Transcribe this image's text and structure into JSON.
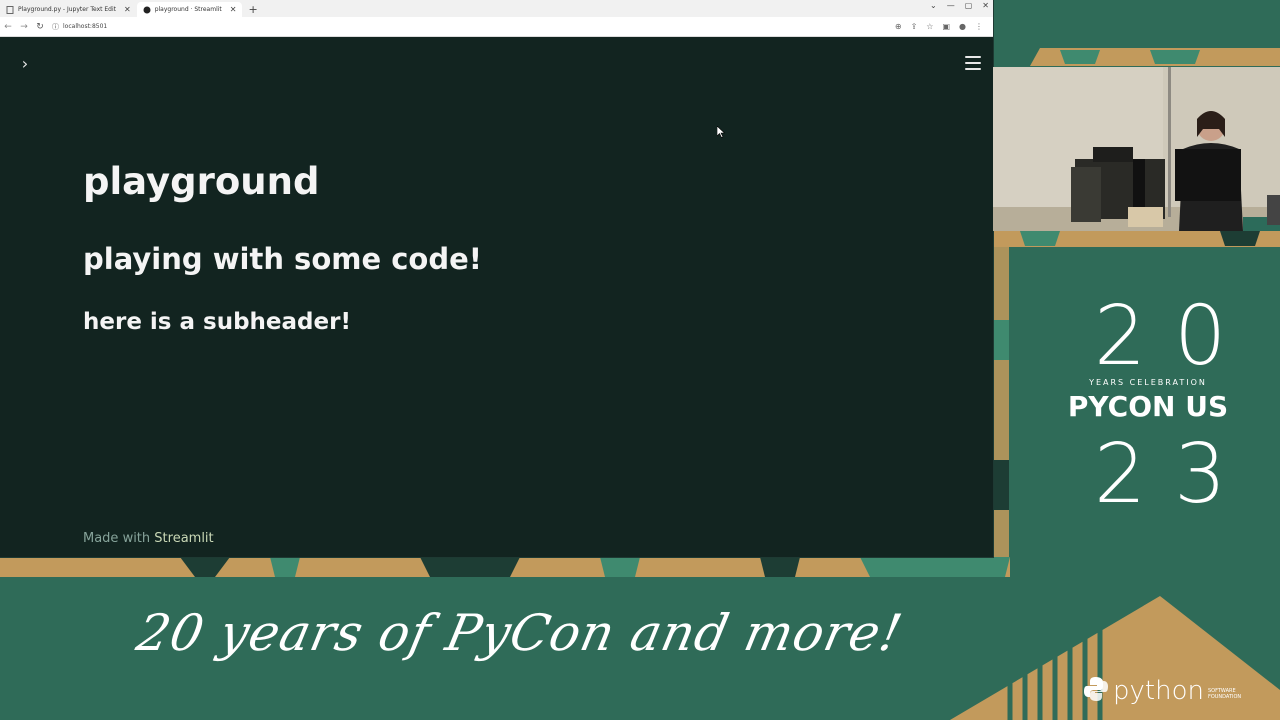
{
  "browser": {
    "tabs": [
      {
        "label": "Playground.py - Jupyter Text Edit",
        "active": false
      },
      {
        "label": "playground · Streamlit",
        "active": true
      }
    ],
    "new_tab": "+",
    "url": "localhost:8501"
  },
  "app": {
    "title": "playground",
    "header": "playing with some code!",
    "subheader": "here is a subheader!",
    "footer_prefix": "Made with ",
    "footer_link": "Streamlit"
  },
  "conference": {
    "year_top": "20",
    "tagline_small": "YEARS CELEBRATION",
    "name": "PYCON US",
    "year_bottom": "23",
    "banner": "20 years of PyCon and more!",
    "psf_word": "python",
    "psf_small_1": "SOFTWARE",
    "psf_small_2": "FOUNDATION"
  },
  "colors": {
    "app_bg": "#122420",
    "conference_green": "#2f6b58",
    "accent_tan": "#c29a5c"
  }
}
